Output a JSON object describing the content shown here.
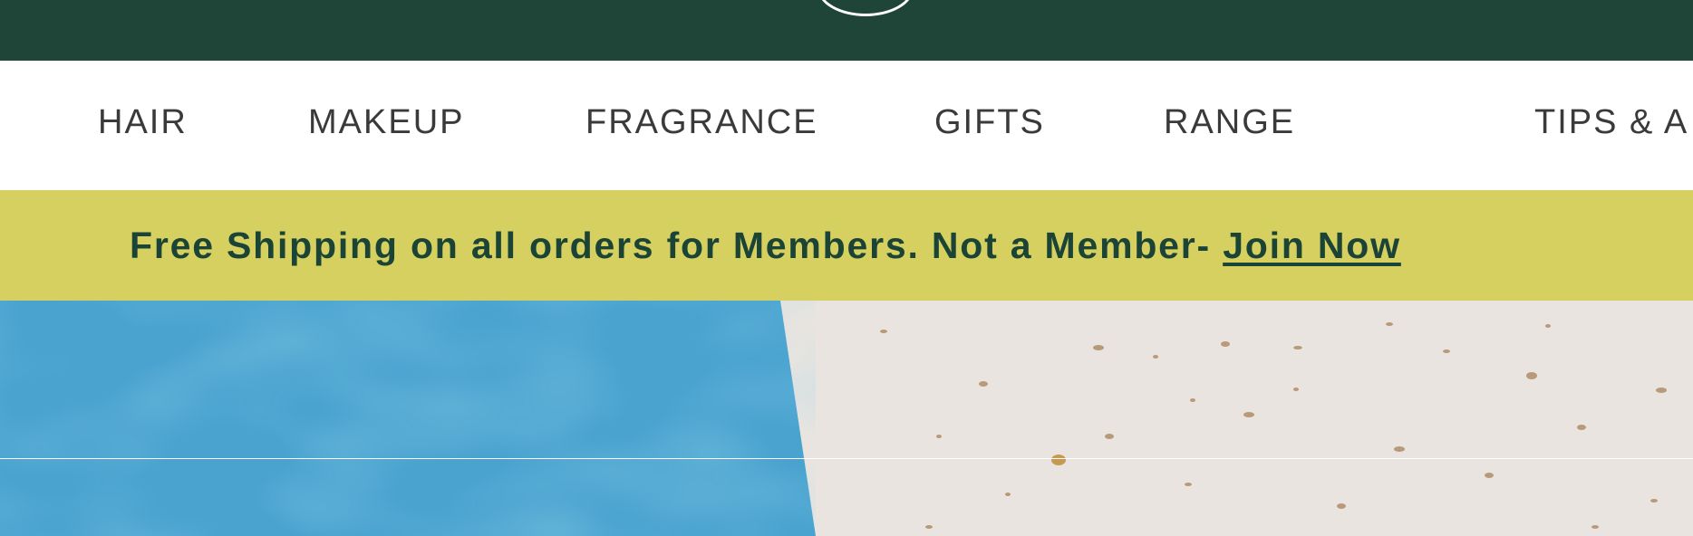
{
  "header": {
    "background": "#1e4538",
    "logo": "brand-logo-ring"
  },
  "nav": {
    "items": [
      {
        "label": "HAIR"
      },
      {
        "label": "MAKEUP"
      },
      {
        "label": "FRAGRANCE"
      },
      {
        "label": "GIFTS"
      },
      {
        "label": "RANGE"
      },
      {
        "label": "TIPS & A"
      }
    ]
  },
  "promo": {
    "text": "Free Shipping on all orders for Members. Not a Member- ",
    "link_label": "Join Now",
    "background": "#d5d05f",
    "text_color": "#1b4437"
  },
  "hero": {
    "left_color": "#4aa3cf",
    "right_color": "#e9e4df"
  }
}
